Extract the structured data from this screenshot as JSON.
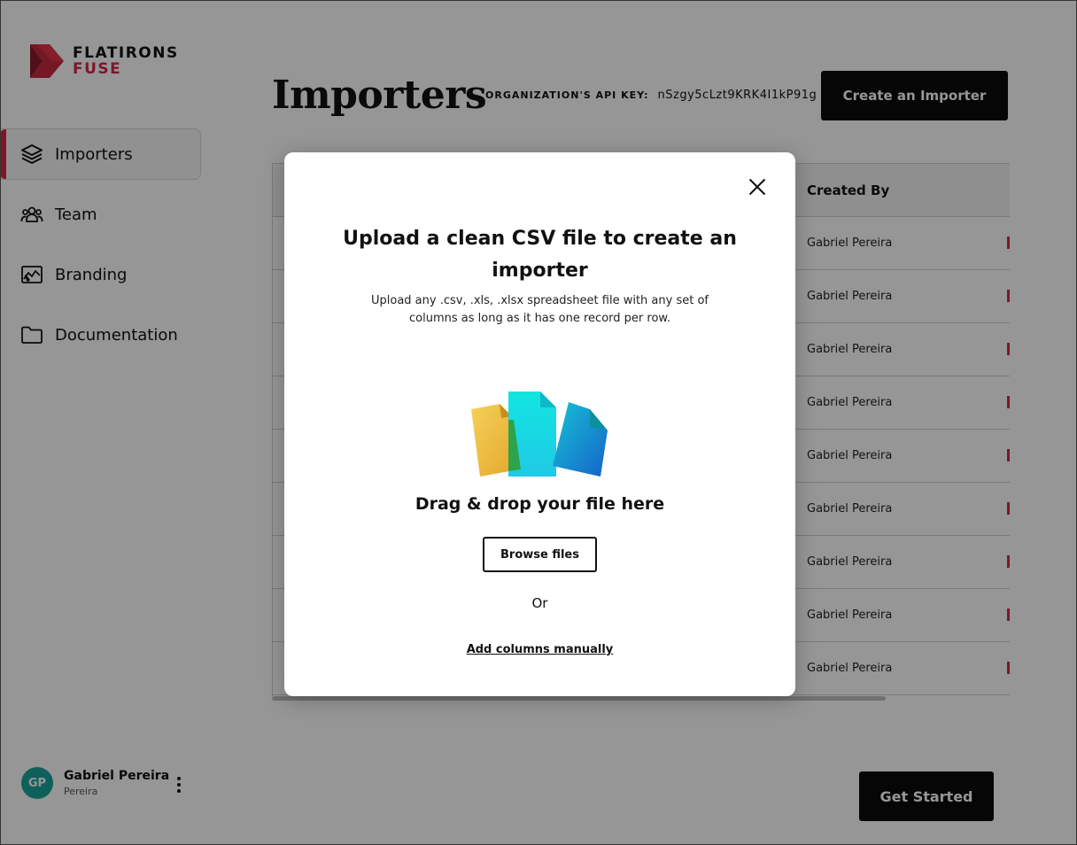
{
  "brand": {
    "line1": "FLATIRONS",
    "line2": "FUSE"
  },
  "nav": [
    {
      "label": "Importers",
      "icon": "layers-icon",
      "active": true
    },
    {
      "label": "Team",
      "icon": "team-icon",
      "active": false
    },
    {
      "label": "Branding",
      "icon": "branding-icon",
      "active": false
    },
    {
      "label": "Documentation",
      "icon": "folder-icon",
      "active": false
    }
  ],
  "user": {
    "initials": "GP",
    "name": "Gabriel Pereira",
    "subtitle": "Pereira"
  },
  "header": {
    "title": "Importers",
    "api_key_label": "ORGANIZATION'S API KEY:",
    "api_key_value": "nSzgy5cLzt9KRK4I1kP91g",
    "create_button": "Create an Importer"
  },
  "table": {
    "created_by_header": "Created By",
    "rows": [
      {
        "created_by": "Gabriel Pereira"
      },
      {
        "created_by": "Gabriel Pereira"
      },
      {
        "created_by": "Gabriel Pereira"
      },
      {
        "created_by": "Gabriel Pereira"
      },
      {
        "created_by": "Gabriel Pereira"
      },
      {
        "created_by": "Gabriel Pereira"
      },
      {
        "created_by": "Gabriel Pereira"
      },
      {
        "created_by": "Gabriel Pereira"
      },
      {
        "created_by": "Gabriel Pereira"
      }
    ]
  },
  "footer": {
    "get_started": "Get Started"
  },
  "modal": {
    "title": "Upload a clean CSV file to create an importer",
    "description": "Upload any .csv, .xls, .xlsx spreadsheet file with any set of columns as long as it has one record per row.",
    "drop_text": "Drag & drop your file here",
    "browse_button": "Browse files",
    "or_text": "Or",
    "manual_link": "Add columns manually"
  },
  "colors": {
    "accent": "#e0233f",
    "brand_red": "#d2284a",
    "avatar": "#1ba39b",
    "button": "#0b0b0b"
  }
}
